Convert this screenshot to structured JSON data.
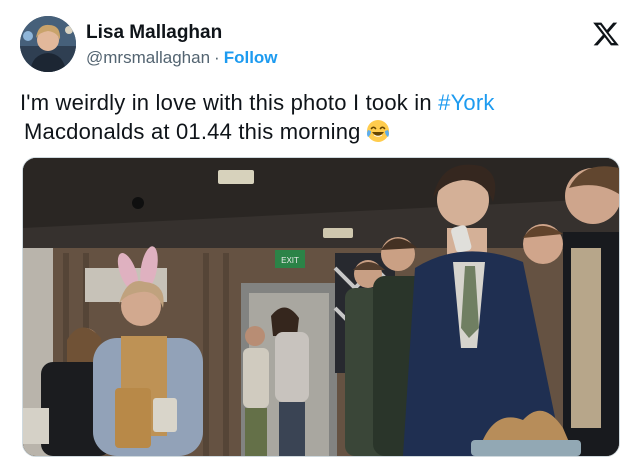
{
  "tweet": {
    "author": {
      "display_name": "Lisa Mallaghan",
      "handle": "@mrsmallaghan",
      "separator": "·",
      "follow_label": "Follow"
    },
    "text": {
      "line1_before": "I'm weirdly in love with this photo I took in ",
      "hashtag": "#York",
      "line2": "Macdonalds at 01.44 this morning",
      "emoji": "face-with-tears-of-joy"
    },
    "icons": {
      "platform_logo": "x-logo-icon",
      "emoji_icon": "face-with-tears-of-joy-icon"
    },
    "photo": {
      "exit_sign_text": "EXIT"
    },
    "colors": {
      "link": "#1d9bf0",
      "text": "#0f1419",
      "secondary": "#536471"
    }
  }
}
